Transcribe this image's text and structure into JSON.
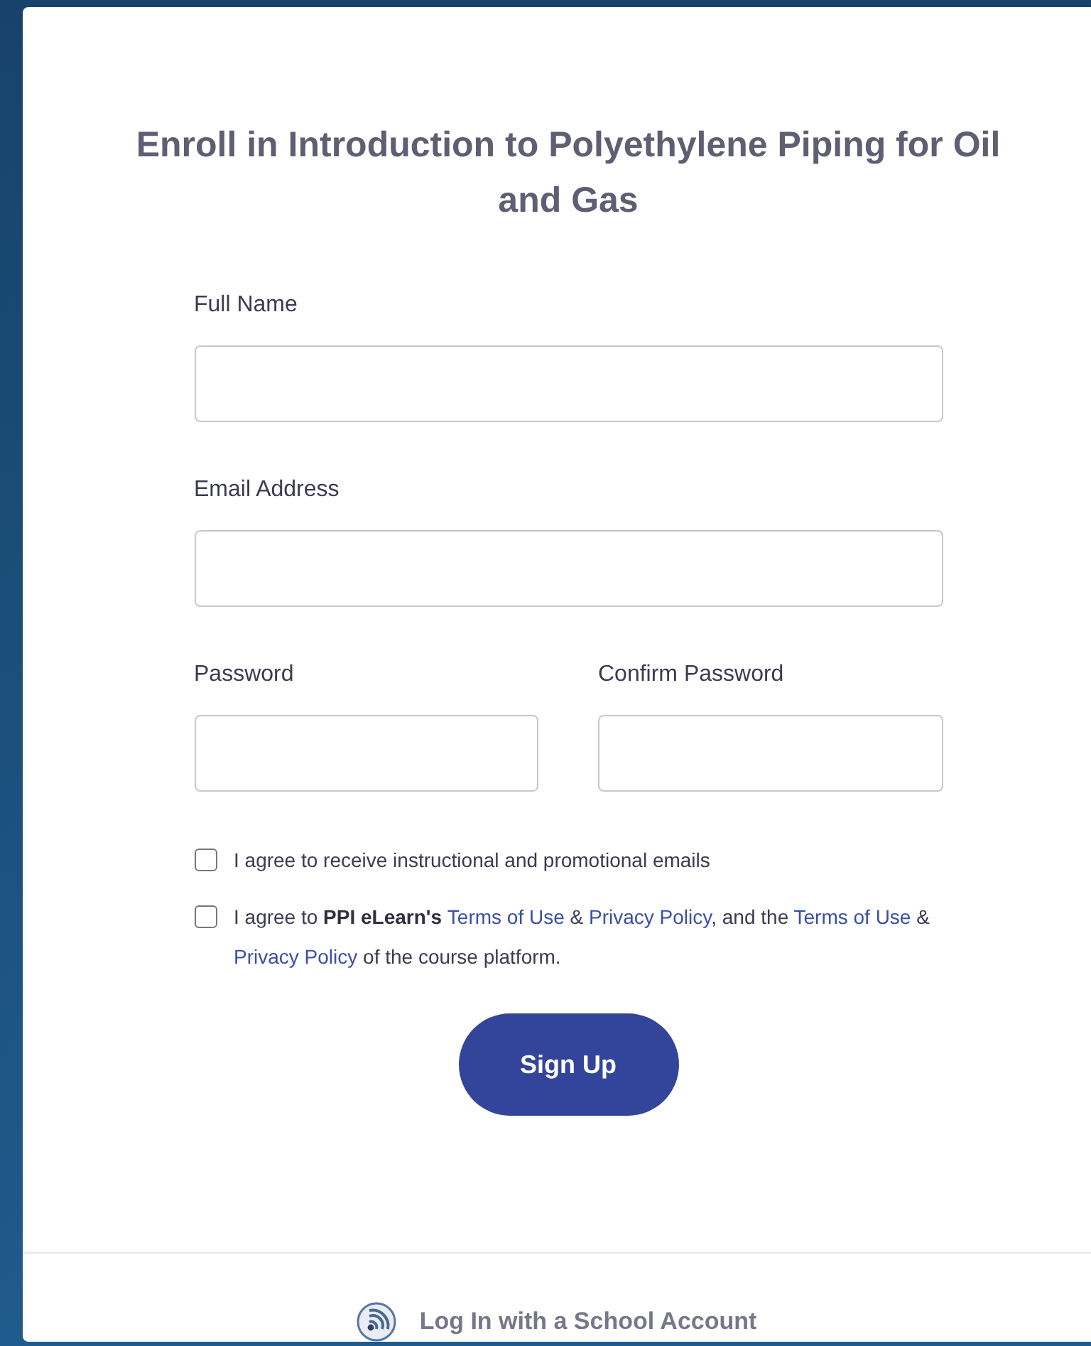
{
  "title": "Enroll in Introduction to Polyethylene Piping for Oil and Gas",
  "fields": [
    {
      "label": "Full Name"
    },
    {
      "label": "Email Address"
    }
  ],
  "password_fields": [
    {
      "label": "Password"
    },
    {
      "label": "Confirm Password"
    }
  ],
  "agreements": [
    {
      "checked": false,
      "segments": [
        {
          "kind": "plain",
          "text": "I agree to receive instructional and promotional emails"
        }
      ]
    },
    {
      "checked": false,
      "segments": [
        {
          "kind": "plain",
          "text": "I agree to "
        },
        {
          "kind": "bold",
          "text": "PPI eLearn's "
        },
        {
          "kind": "link",
          "text": "Terms of Use"
        },
        {
          "kind": "plain",
          "text": " & "
        },
        {
          "kind": "link",
          "text": "Privacy Policy"
        },
        {
          "kind": "plain",
          "text": ", and the "
        },
        {
          "kind": "link",
          "text": "Terms of Use"
        },
        {
          "kind": "plain",
          "text": " & "
        },
        {
          "kind": "link",
          "text": "Privacy Policy"
        },
        {
          "kind": "plain",
          "text": " of the course platform."
        }
      ]
    }
  ],
  "submit": "Sign Up",
  "footer_link": "Log In with a School Account"
}
